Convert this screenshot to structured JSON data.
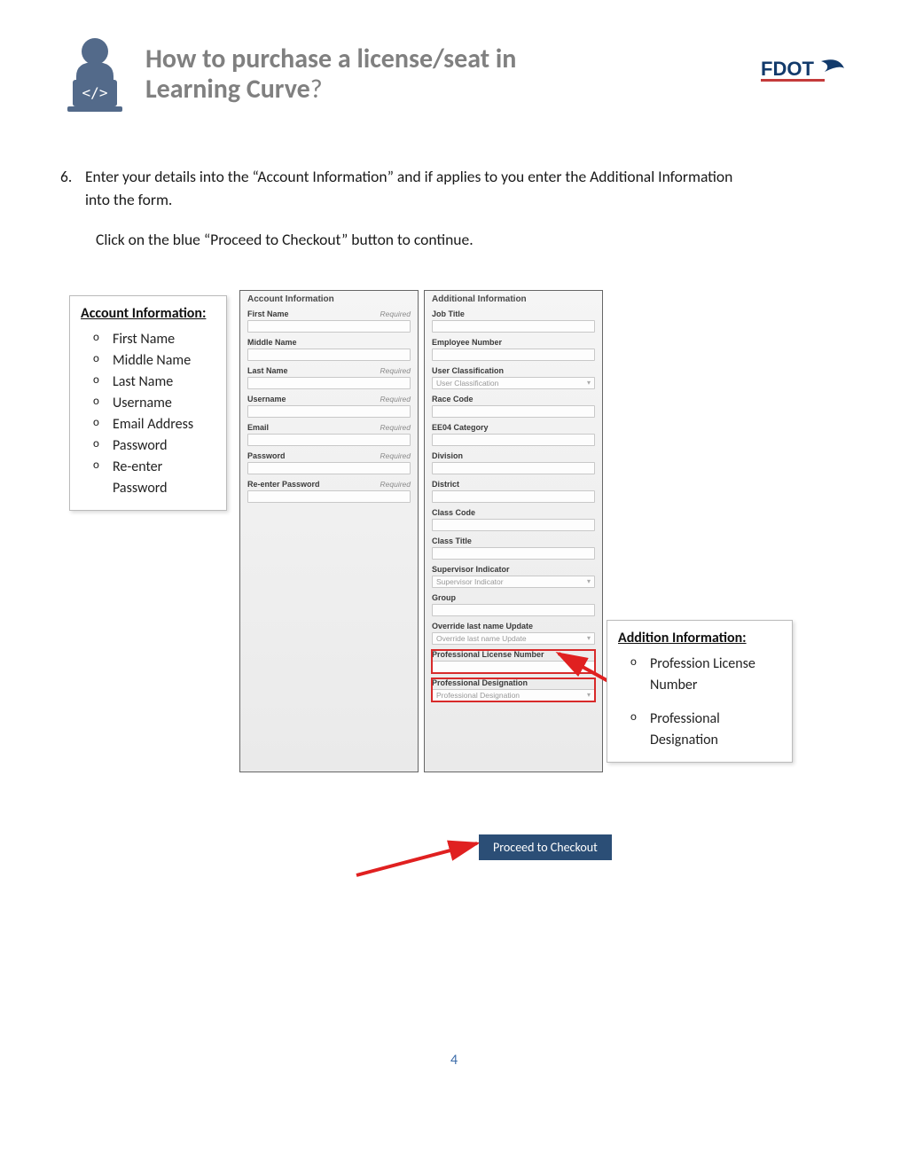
{
  "header": {
    "title_line1": "How to purchase a license/seat in",
    "title_line2": "Learning Curve",
    "title_qmark": "?",
    "logo_text": "FDOT"
  },
  "step": {
    "num": "6.",
    "text1": "Enter your details into the “Account Information” and if applies to you enter the Additional Information into the form.",
    "text2": "Click on the blue “Proceed to Checkout” button to continue."
  },
  "callout_left": {
    "title": "Account Information:",
    "items": [
      "First Name",
      "Middle Name",
      "Last Name",
      "Username",
      "Email Address",
      "Password",
      "Re-enter Password"
    ]
  },
  "callout_right": {
    "title": "Addition Information:",
    "items": [
      "Profession License Number",
      "Professional Designation"
    ]
  },
  "panel_left": {
    "title": "Account Information",
    "fields": [
      {
        "label": "First Name",
        "required": "Required"
      },
      {
        "label": "Middle Name",
        "required": ""
      },
      {
        "label": "Last Name",
        "required": "Required"
      },
      {
        "label": "Username",
        "required": "Required"
      },
      {
        "label": "Email",
        "required": "Required"
      },
      {
        "label": "Password",
        "required": "Required"
      },
      {
        "label": "Re-enter Password",
        "required": "Required"
      }
    ]
  },
  "panel_right": {
    "title": "Additional Information",
    "fields": [
      {
        "label": "Job Title"
      },
      {
        "label": "Employee Number"
      },
      {
        "label": "User Classification",
        "placeholder": "User Classification",
        "dropdown": true
      },
      {
        "label": "Race Code"
      },
      {
        "label": "EE04 Category"
      },
      {
        "label": "Division"
      },
      {
        "label": "District"
      },
      {
        "label": "Class Code"
      },
      {
        "label": "Class Title"
      },
      {
        "label": "Supervisor Indicator",
        "placeholder": "Supervisor Indicator",
        "dropdown": true
      },
      {
        "label": "Group"
      },
      {
        "label": "Override last name Update",
        "placeholder": "Override last name Update",
        "dropdown": true
      },
      {
        "label": "Professional License Number",
        "highlight": true
      },
      {
        "label": "Professional Designation",
        "placeholder": "Professional Designation",
        "dropdown": true,
        "highlight": true
      }
    ]
  },
  "button": {
    "label": "Proceed to Checkout"
  },
  "page_number": "4"
}
